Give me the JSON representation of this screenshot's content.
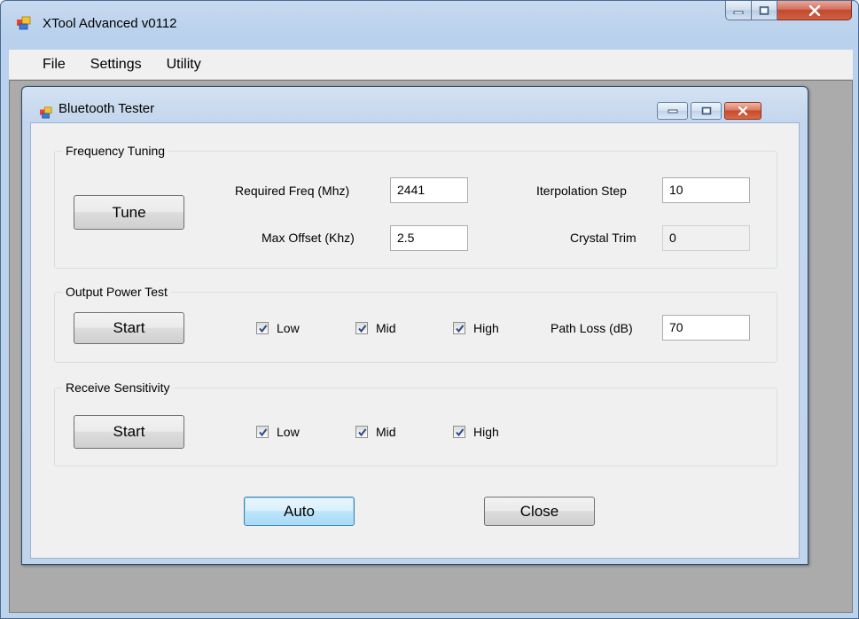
{
  "app": {
    "title": "XTool Advanced v0112",
    "menu": [
      "File",
      "Settings",
      "Utility"
    ]
  },
  "child": {
    "title": "Bluetooth Tester"
  },
  "frequency_tuning": {
    "caption": "Frequency Tuning",
    "tune_button": "Tune",
    "required_freq_label": "Required Freq (Mhz)",
    "required_freq_value": "2441",
    "max_offset_label": "Max Offset (Khz)",
    "max_offset_value": "2.5",
    "interpolation_step_label": "Iterpolation Step",
    "interpolation_step_value": "10",
    "crystal_trim_label": "Crystal Trim",
    "crystal_trim_value": "0"
  },
  "output_power": {
    "caption": "Output Power Test",
    "start_button": "Start",
    "checks": [
      {
        "label": "Low",
        "checked": true
      },
      {
        "label": "Mid",
        "checked": true
      },
      {
        "label": "High",
        "checked": true
      }
    ],
    "path_loss_label": "Path Loss (dB)",
    "path_loss_value": "70"
  },
  "receive_sensitivity": {
    "caption": "Receive Sensitivity",
    "start_button": "Start",
    "checks": [
      {
        "label": "Low",
        "checked": true
      },
      {
        "label": "Mid",
        "checked": true
      },
      {
        "label": "High",
        "checked": true
      }
    ]
  },
  "footer": {
    "auto_button": "Auto",
    "close_button": "Close"
  }
}
